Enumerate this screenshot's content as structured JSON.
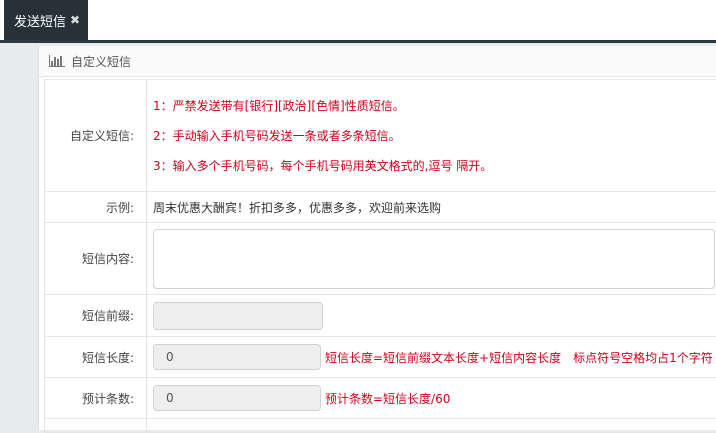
{
  "tab": {
    "label": "发送短信",
    "close": "✖"
  },
  "panel": {
    "title": "自定义短信"
  },
  "form": {
    "custom_label": "自定义短信:",
    "rules": [
      "1：严禁发送带有[银行][政治][色情]性质短信。",
      "2：手动输入手机号码发送一条或者多条短信。",
      "3：输入多个手机号码，每个手机号码用英文格式的,逗号 隔开。"
    ],
    "example_label": "示例:",
    "example_text": "周末优惠大酬宾！折扣多多，优惠多多，欢迎前来选购",
    "content_label": "短信内容:",
    "prefix_label": "短信前缀:",
    "length_label": "短信长度:",
    "length_value": "0",
    "length_hint": "短信长度=短信前缀文本长度+短信内容长度　标点符号空格均占1个字符",
    "count_label": "预计条数:",
    "count_value": "0",
    "count_hint": "预计条数=短信长度/60"
  },
  "colors": {
    "tab_bg": "#263238",
    "warning_red": "#d0021b"
  }
}
